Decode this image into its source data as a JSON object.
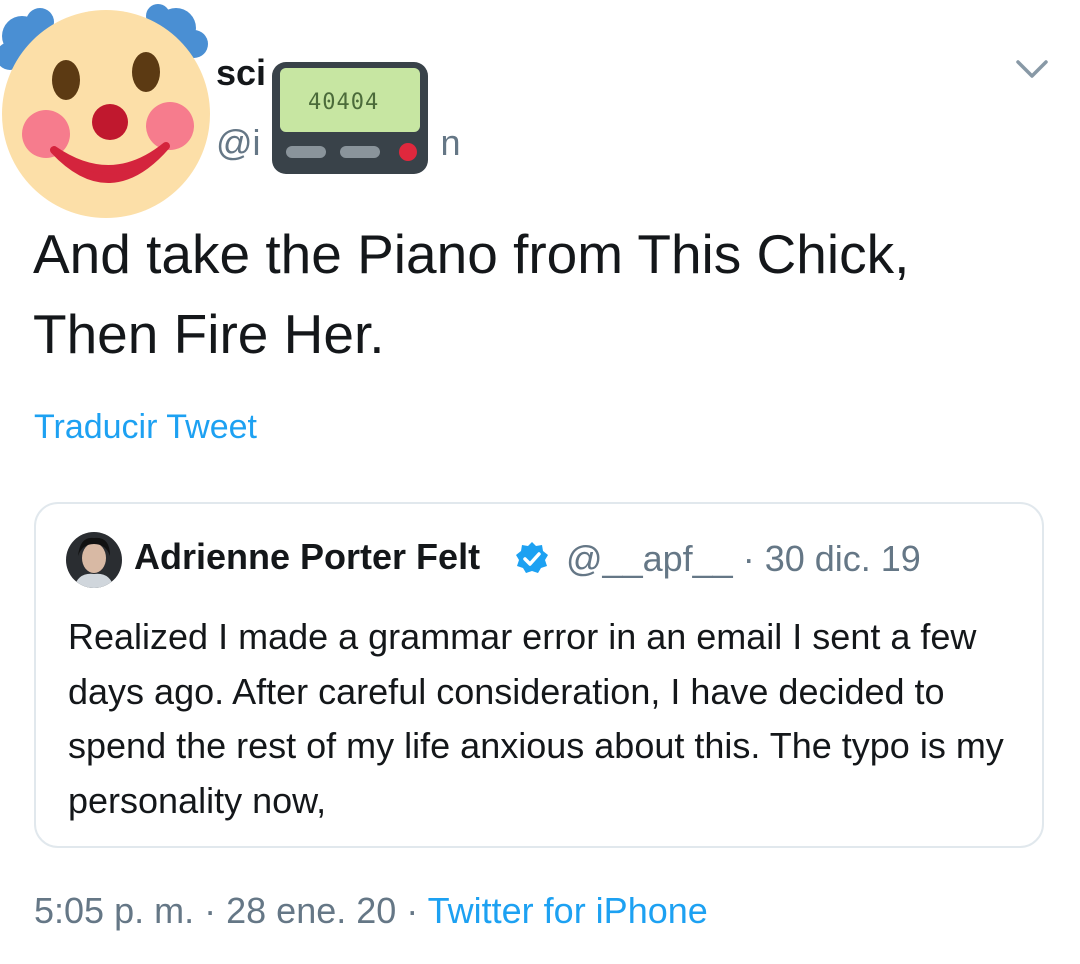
{
  "author": {
    "name_partial": "sci",
    "handle_prefix": "@i",
    "handle_suffix": "n",
    "avatar_icon": "clown-face-icon",
    "sticker_icon": "pager-icon",
    "pager_display": "40404"
  },
  "tweet": {
    "text_line1": "And take the Piano from This Chick,",
    "text_line2": "Then Fire Her.",
    "translate_label": "Traducir Tweet"
  },
  "quote": {
    "name": "Adrienne Porter Felt",
    "handle": "@__apf__",
    "separator": "·",
    "date": "30 dic. 19",
    "verified_icon": "verified-badge-icon",
    "text": "Realized I made a grammar error in an email I sent a few days ago. After careful consideration, I have decided to spend the rest of my life anxious about this. The typo is my personality now,"
  },
  "footer": {
    "time": "5:05 p. m.",
    "separator1": "·",
    "date": "28 ene. 20",
    "separator2": "·",
    "source": "Twitter for iPhone"
  },
  "menu_icon": "chevron-down-icon",
  "colors": {
    "accent": "#1da1f2",
    "text": "#14171a",
    "secondary": "#657786",
    "border": "#e1e8ed"
  }
}
